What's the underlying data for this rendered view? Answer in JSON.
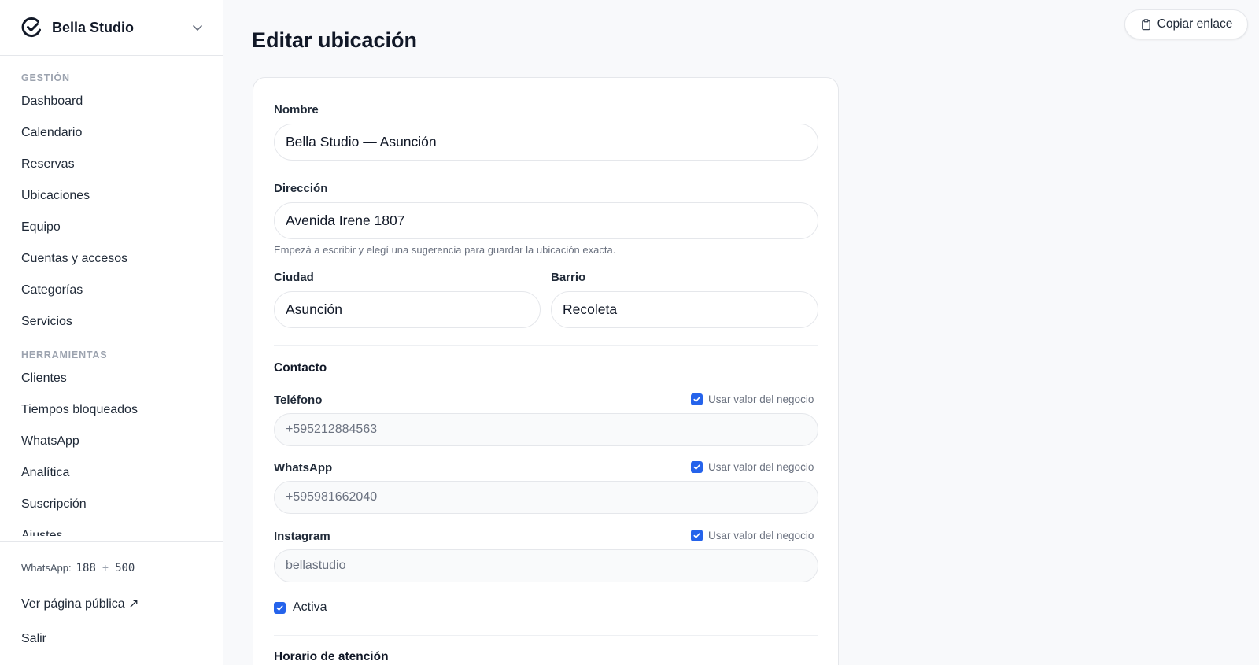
{
  "sidebar": {
    "brand": "Bella Studio",
    "section_gestion": "GESTIÓN",
    "gestion_items": [
      "Dashboard",
      "Calendario",
      "Reservas",
      "Ubicaciones",
      "Equipo",
      "Cuentas y accesos",
      "Categorías",
      "Servicios"
    ],
    "section_herramientas": "HERRAMIENTAS",
    "herramientas_items": [
      "Clientes",
      "Tiempos bloqueados",
      "WhatsApp",
      "Analítica",
      "Suscripción",
      "Ajustes"
    ],
    "footer": {
      "whatsapp_label": "WhatsApp:",
      "whatsapp_used": "188",
      "whatsapp_plus": "+",
      "whatsapp_extra": "500",
      "public_page": "Ver página pública ↗",
      "logout": "Salir"
    }
  },
  "header": {
    "title": "Editar ubicación",
    "copy_link": "Copiar enlace"
  },
  "form": {
    "nombre_label": "Nombre",
    "nombre_value": "Bella Studio — Asunción",
    "direccion_label": "Dirección",
    "direccion_value": "Avenida Irene 1807",
    "direccion_hint": "Empezá a escribir y elegí una sugerencia para guardar la ubicación exacta.",
    "ciudad_label": "Ciudad",
    "ciudad_value": "Asunción",
    "barrio_label": "Barrio",
    "barrio_value": "Recoleta",
    "contacto_title": "Contacto",
    "use_business_value": "Usar valor del negocio",
    "telefono_label": "Teléfono",
    "telefono_value": "+595212884563",
    "whatsapp_label": "WhatsApp",
    "whatsapp_value": "+595981662040",
    "instagram_label": "Instagram",
    "instagram_value": "bellastudio",
    "activa_label": "Activa",
    "horario_title": "Horario de atención"
  },
  "colors": {
    "accent": "#2563eb",
    "border": "#e5e7eb",
    "muted": "#9ca3af"
  }
}
